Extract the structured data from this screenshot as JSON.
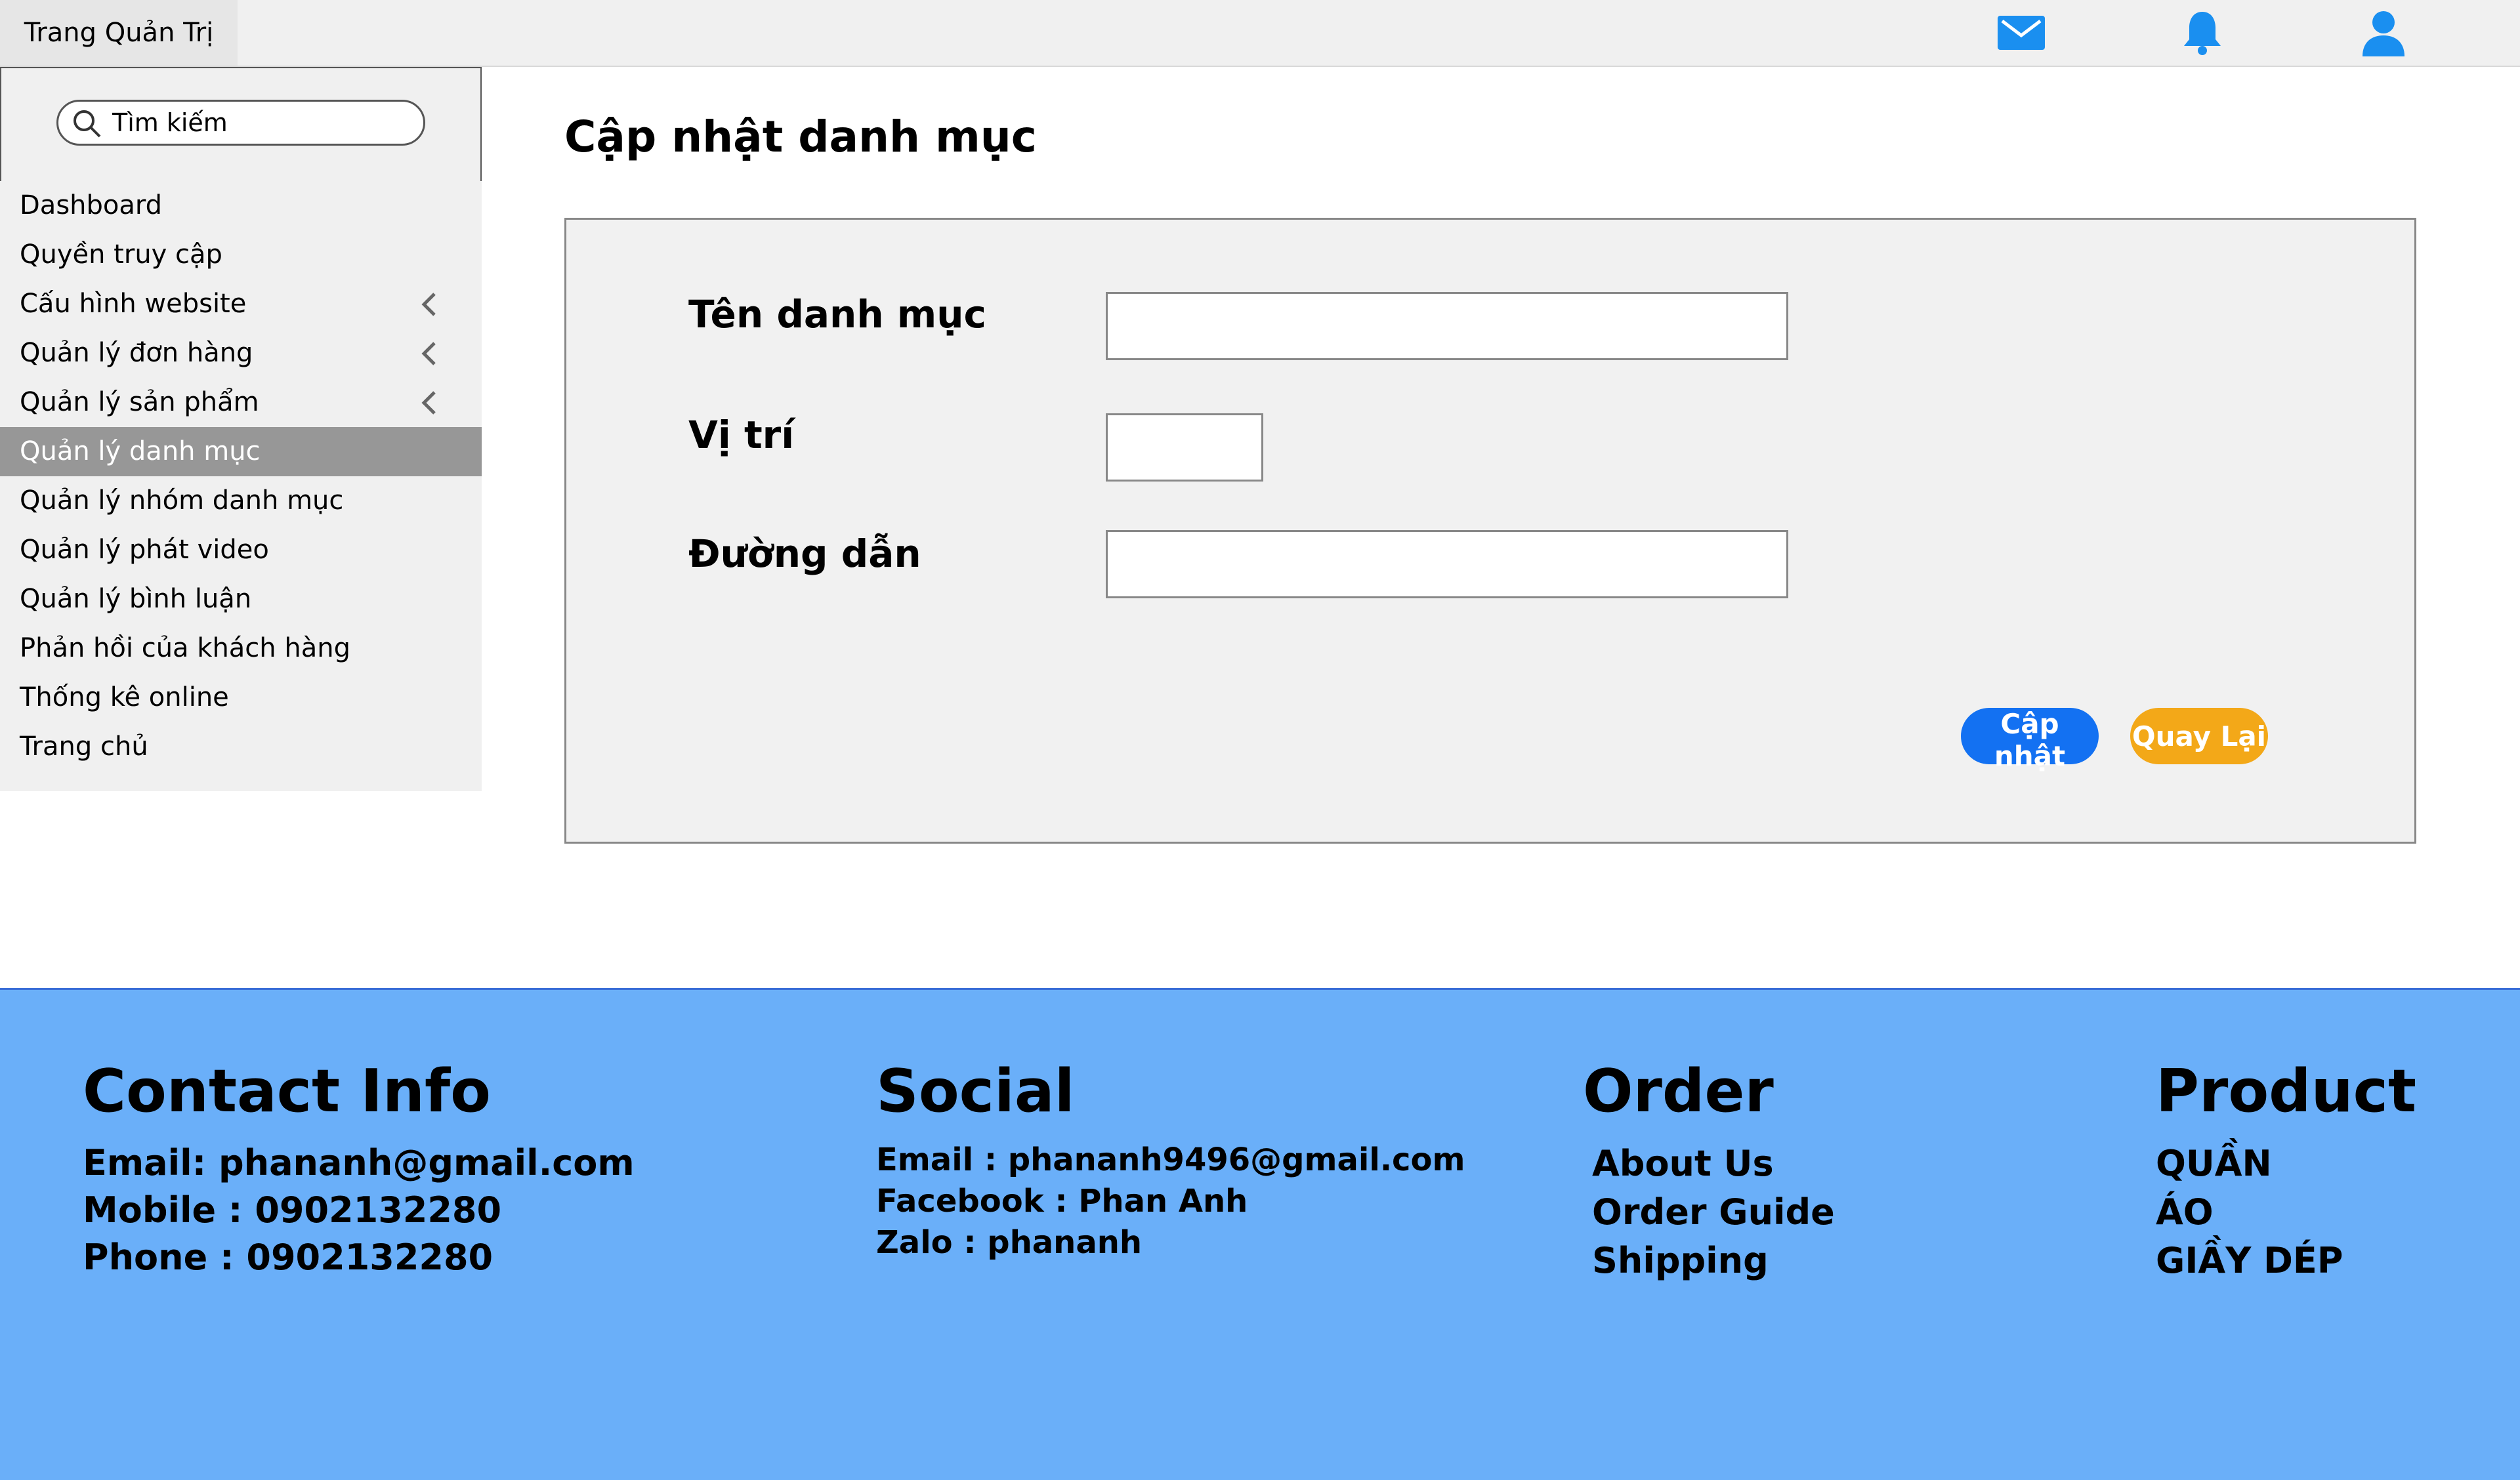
{
  "app": {
    "title": "Trang Quản Trị",
    "top_icons": [
      "mail-icon",
      "bell-icon",
      "user-icon"
    ],
    "accent_icon_color": "#1a8ff0"
  },
  "sidebar": {
    "search_placeholder": "Tìm kiếm",
    "items": [
      {
        "label": "Dashboard",
        "expandable": false,
        "active": false
      },
      {
        "label": "Quyền truy cập",
        "expandable": false,
        "active": false
      },
      {
        "label": "Cấu hình website",
        "expandable": true,
        "active": false
      },
      {
        "label": "Quản lý đơn hàng",
        "expandable": true,
        "active": false
      },
      {
        "label": "Quản lý sản phẩm",
        "expandable": true,
        "active": false
      },
      {
        "label": "Quản lý danh mục",
        "expandable": false,
        "active": true
      },
      {
        "label": "Quản lý nhóm danh mục",
        "expandable": false,
        "active": false
      },
      {
        "label": "Quản lý phát video",
        "expandable": false,
        "active": false
      },
      {
        "label": "Quản lý bình luận",
        "expandable": false,
        "active": false
      },
      {
        "label": "Phản hồi của khách hàng",
        "expandable": false,
        "active": false
      },
      {
        "label": "Thống kê online",
        "expandable": false,
        "active": false
      },
      {
        "label": "Trang chủ",
        "expandable": false,
        "active": false
      }
    ]
  },
  "main": {
    "title": "Cập nhật danh mục",
    "form": {
      "name_label": "Tên danh mục",
      "name_value": "",
      "position_label": "Vị trí",
      "position_value": "",
      "path_label": "Đường dẫn",
      "path_value": "",
      "update_button": "Cập nhật",
      "back_button": "Quay Lại"
    },
    "colors": {
      "update_button": "#1371f2",
      "back_button": "#f3a818"
    }
  },
  "footer": {
    "background": "#6aaff9",
    "contact": {
      "heading": "Contact Info",
      "lines": [
        "Email: phananh@gmail.com",
        "Mobile : 0902132280",
        "Phone : 0902132280"
      ]
    },
    "social": {
      "heading": "Social",
      "lines": [
        "Email : phananh9496@gmail.com",
        "Facebook : Phan Anh",
        "Zalo : phananh"
      ]
    },
    "order": {
      "heading": "Order",
      "links": [
        "About Us",
        "Order Guide",
        "Shipping"
      ]
    },
    "product": {
      "heading": "Product",
      "links": [
        "QUẦN",
        "ÁO",
        "GIẦY DÉP"
      ]
    }
  }
}
